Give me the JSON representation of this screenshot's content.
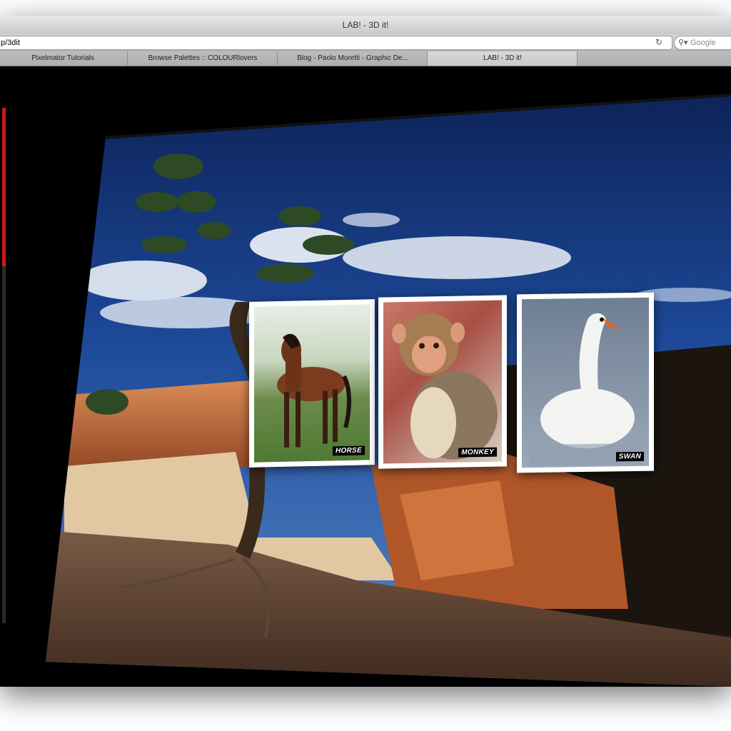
{
  "window": {
    "title": "LAB! - 3D it!"
  },
  "toolbar": {
    "url": "p/3dit",
    "search_placeholder": "Google"
  },
  "tabs": [
    {
      "label": "Pixelmator Tutorials"
    },
    {
      "label": "Browse Palettes :: COLOURlovers"
    },
    {
      "label": "Blog - Paolo Moretti - Graphic De..."
    },
    {
      "label": "LAB! - 3D it!"
    }
  ],
  "gallery": {
    "cards": [
      {
        "caption": "HORSE"
      },
      {
        "caption": "MONKEY"
      },
      {
        "caption": "SWAN"
      }
    ]
  },
  "icons": {
    "reload": "reload-icon",
    "search": "search-icon"
  },
  "colors": {
    "scroll_accent": "#cc1a1a",
    "page_background": "#000000"
  }
}
